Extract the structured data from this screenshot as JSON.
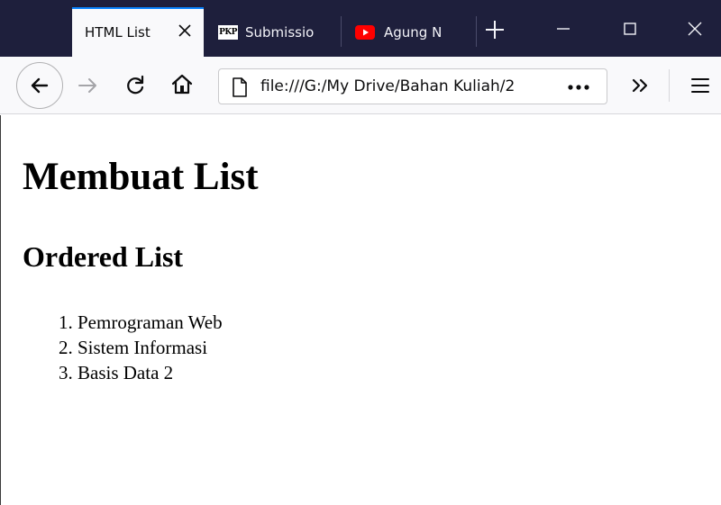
{
  "tabs": [
    {
      "label": "HTML List",
      "icon": "none"
    },
    {
      "label": "Submissio",
      "icon": "pkp-icon",
      "icon_text": "PKP"
    },
    {
      "label": "Agung N",
      "icon": "youtube-icon"
    }
  ],
  "window_controls": [
    "new-tab",
    "minimize",
    "maximize",
    "close"
  ],
  "toolbar": {
    "url": "file:///G:/My Drive/Bahan Kuliah/2",
    "page_actions": "•••"
  },
  "page": {
    "heading": "Membuat List",
    "subheading": "Ordered List",
    "list_items": [
      {
        "number": "1.",
        "text": "Pemrograman Web"
      },
      {
        "number": "2.",
        "text": "Sistem Informasi"
      },
      {
        "number": "3.",
        "text": "Basis Data 2"
      }
    ]
  },
  "colors": {
    "tabstrip": "#1e1f3c",
    "toolbar": "#f9f9fb",
    "accent": "#0a84ff",
    "youtube": "#ff0000"
  }
}
